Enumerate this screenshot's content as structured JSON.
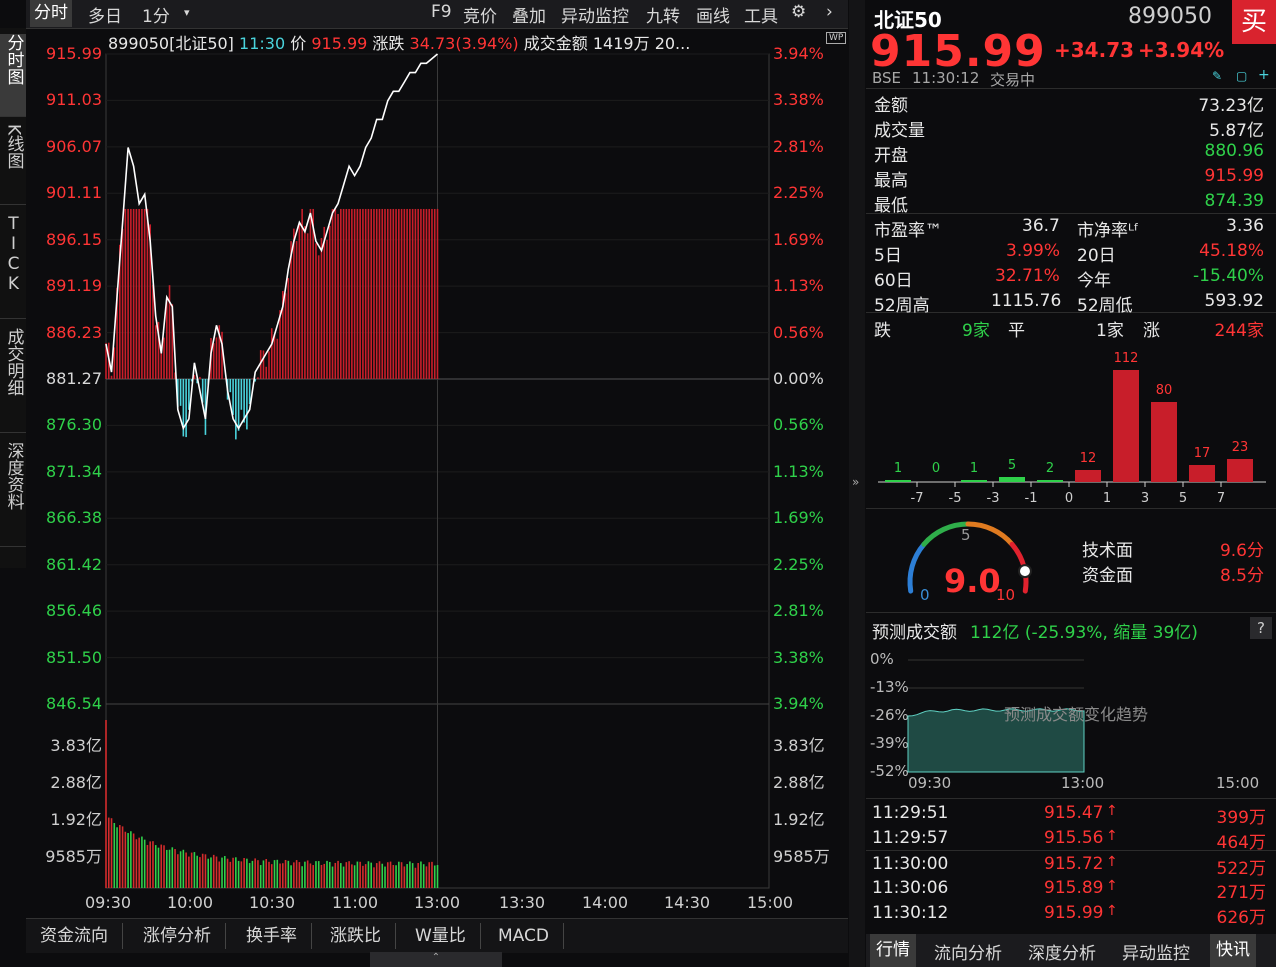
{
  "toolbar": {
    "tabs": [
      "分时",
      "多日",
      "1分"
    ],
    "dropdown_icon": "caret-down-icon",
    "tools": [
      "F9",
      "竞价",
      "叠加",
      "异动监控",
      "九转",
      "画线",
      "工具"
    ],
    "settings_icon": "gear-icon",
    "next_icon": "chevron-right-icon"
  },
  "vtabs": [
    "分时图",
    "K线图",
    "TICK",
    "成交明细",
    "深度资料"
  ],
  "info": {
    "code_name": "899050[北证50]",
    "time": "11:30",
    "price_label": "价",
    "price": "915.99",
    "change_label": "涨跌",
    "change": "34.73(3.94%)",
    "amount_label": "成交金额",
    "amount": "1419万",
    "extra": "20..."
  },
  "wp_badge": "WP",
  "price_axis": {
    "left": [
      "915.99",
      "911.03",
      "906.07",
      "901.11",
      "896.15",
      "891.19",
      "886.23",
      "881.27",
      "876.30",
      "871.34",
      "866.38",
      "861.42",
      "856.46",
      "851.50",
      "846.54"
    ],
    "right": [
      "3.94%",
      "3.38%",
      "2.81%",
      "2.25%",
      "1.69%",
      "1.13%",
      "0.56%",
      "0.00%",
      "0.56%",
      "1.13%",
      "1.69%",
      "2.25%",
      "2.81%",
      "3.38%",
      "3.94%"
    ]
  },
  "volume_axis": [
    "3.83亿",
    "2.88亿",
    "1.92亿",
    "9585万"
  ],
  "time_axis": [
    "09:30",
    "10:00",
    "10:30",
    "11:00",
    "13:00",
    "13:30",
    "14:00",
    "14:30",
    "15:00"
  ],
  "chart_data": {
    "type": "line",
    "title": "899050[北证50]",
    "x_range": [
      "09:30",
      "15:00"
    ],
    "ylim": [
      846.54,
      915.99
    ],
    "baseline": 881.27,
    "series": [
      {
        "x_minutes": [
          0,
          2,
          4,
          6,
          8,
          10,
          12,
          14,
          16,
          18,
          20,
          22,
          24,
          26,
          28,
          30,
          32,
          34,
          36,
          38,
          40,
          42,
          44,
          46,
          48,
          50,
          52,
          54,
          56,
          58,
          60,
          62,
          64,
          66,
          68,
          70,
          72,
          74,
          76,
          78,
          80,
          82,
          84,
          86,
          88,
          90,
          92,
          94,
          96,
          98,
          100,
          102,
          104,
          106,
          108,
          110,
          112,
          114,
          116,
          118,
          120
        ],
        "values": [
          885,
          882,
          890,
          898,
          906,
          904,
          900,
          901,
          896,
          888,
          884,
          890,
          889,
          878,
          876,
          877,
          883,
          880,
          877,
          884,
          887,
          885,
          880,
          877,
          876,
          877,
          878,
          882,
          883,
          884,
          885,
          887,
          889,
          893,
          896,
          898,
          897,
          899,
          896,
          895,
          897,
          899,
          900,
          902,
          904,
          903,
          904,
          906,
          907,
          909,
          909,
          911,
          912,
          912,
          913,
          914,
          914,
          915,
          915,
          915.5,
          915.99
        ]
      }
    ],
    "bars_red_green": "market breadth bars around baseline",
    "volume_ylim": [
      0,
      383000000
    ]
  },
  "bottom_tabs": [
    "资金流向",
    "涨停分析",
    "换手率",
    "涨跌比",
    "W量比",
    "MACD"
  ],
  "expand_icon": "chevron-up-icon",
  "collapse_icon": "chevron-right-icon",
  "quote": {
    "name": "北证50",
    "code": "899050",
    "buy": "买",
    "price": "915.99",
    "change": "+34.73",
    "change_pct": "+3.94%",
    "market": "BSE",
    "time": "11:30:12",
    "status": "交易中"
  },
  "stats": {
    "amount_label": "金额",
    "amount": "73.23亿",
    "volume_label": "成交量",
    "volume": "5.87亿",
    "open_label": "开盘",
    "open": "880.96",
    "high_label": "最高",
    "high": "915.99",
    "low_label": "最低",
    "low": "874.39",
    "pe_label": "市盈率™",
    "pe": "36.7",
    "pb_label": "市净率ᴸᶠ",
    "pb": "3.36",
    "d5_label": "5日",
    "d5": "3.99%",
    "d20_label": "20日",
    "d20": "45.18%",
    "d60_label": "60日",
    "d60": "32.71%",
    "ytd_label": "今年",
    "ytd": "-15.40%",
    "w52h_label": "52周高",
    "w52h": "1115.76",
    "w52l_label": "52周低",
    "w52l": "593.92"
  },
  "breadth": {
    "down_label": "跌",
    "down": "9家",
    "flat_label": "平",
    "flat": "1家",
    "up_label": "涨",
    "up": "244家",
    "bins": [
      "-7",
      "-5",
      "-3",
      "-1",
      "0",
      "1",
      "3",
      "5",
      "7"
    ],
    "counts": [
      1,
      0,
      1,
      5,
      2,
      12,
      112,
      80,
      17,
      23
    ]
  },
  "score": {
    "value": "9.0",
    "min": "0",
    "mid": "5",
    "max": "10",
    "gauge_fraction": 0.9,
    "tech_label": "技术面",
    "tech": "9.6分",
    "fund_label": "资金面",
    "fund": "8.5分"
  },
  "forecast": {
    "label": "预测成交额",
    "value": "112亿 (-25.93%, 缩量 39亿)",
    "help": "?",
    "y_ticks": [
      "0%",
      "-13%",
      "-26%",
      "-39%",
      "-52%"
    ],
    "x_ticks": [
      "09:30",
      "13:00",
      "15:00"
    ],
    "watermark": "预测成交额变化趋势"
  },
  "ticks": [
    {
      "time": "11:29:51",
      "price": "915.47",
      "vol": "399万"
    },
    {
      "time": "11:29:57",
      "price": "915.56",
      "vol": "464万"
    },
    {
      "time": "11:30:00",
      "price": "915.72",
      "vol": "522万"
    },
    {
      "time": "11:30:06",
      "price": "915.89",
      "vol": "271万"
    },
    {
      "time": "11:30:12",
      "price": "915.99",
      "vol": "626万"
    }
  ],
  "right_tabs": [
    "行情",
    "流向分析",
    "深度分析",
    "异动监控",
    "快讯"
  ],
  "colors": {
    "up": "#ff3535",
    "down": "#2fd14a",
    "line": "#ffffff",
    "cyan": "#4ad3dc",
    "bar_red": "#c81e2a"
  }
}
